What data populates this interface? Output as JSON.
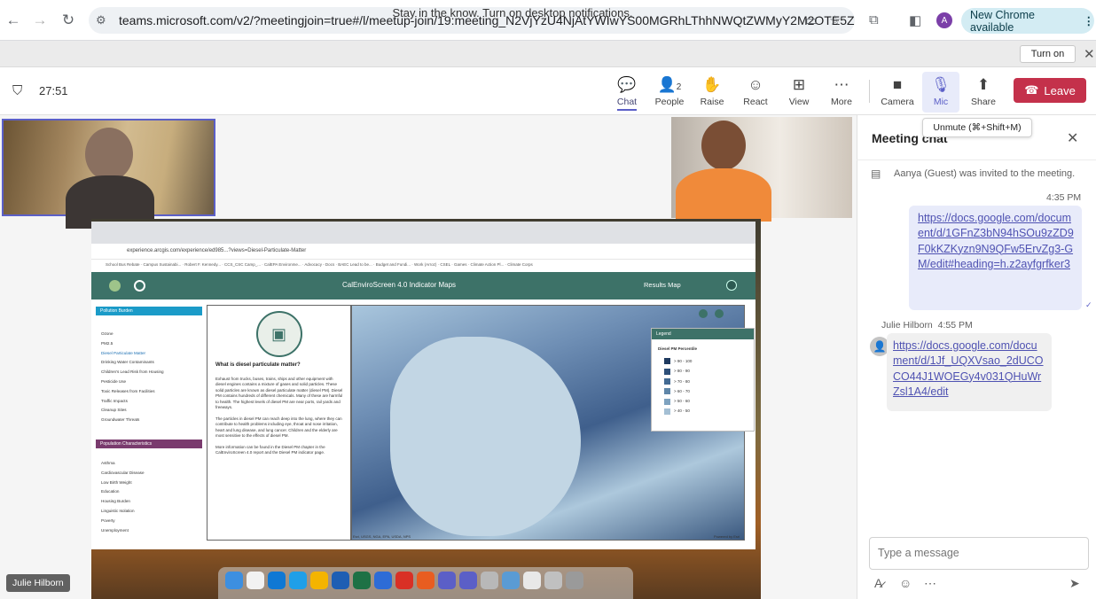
{
  "browser": {
    "url": "teams.microsoft.com/v2/?meetingjoin=true#/l/meetup-join/19:meeting_N2VjYzU4NjAtYWIwYS00MGRhLThhNWQtZWMyY2M2OTE5Zj...",
    "profile_initial": "A",
    "new_chrome_label": "New Chrome available"
  },
  "notification": {
    "text": "Stay in the know. Turn on desktop notifications.",
    "turn_on_label": "Turn on"
  },
  "meeting": {
    "timer": "27:51",
    "people_count": "2",
    "toolbar": {
      "chat": "Chat",
      "people": "People",
      "raise": "Raise",
      "react": "React",
      "view": "View",
      "more": "More",
      "camera": "Camera",
      "mic": "Mic",
      "share": "Share",
      "leave": "Leave"
    },
    "mic_tooltip": "Unmute (⌘+Shift+M)",
    "presenter_name": "Julie Hilborn"
  },
  "shared_screen": {
    "url": "experience.arcgis.com/experience/ed985...?views=Diesel-Particulate-Matter",
    "bookmarks": "School Bus Rebate · Campus Sustainabi... · Robert F. Kennedy... · CCS_CSC Camp_... · CalEPA Environme... · Advocacy - Docs · BAEC Lead to be... · Budget and Fundi... · Work (Arroz) · CSEL · Games · Climate Action Pl... · Climate Corps",
    "app_title": "CalEnviroScreen 4.0 Indicator Maps",
    "results_map": "Results Map",
    "pollution_header": "Pollution Burden",
    "pollution_items": [
      "Ozone",
      "PM2.5",
      "Diesel Particulate Matter",
      "Drinking Water Contaminants",
      "Children's Lead Risk from Housing",
      "Pesticide Use",
      "Toxic Releases from Facilities",
      "Traffic Impacts",
      "Cleanup Sites",
      "Groundwater Threats"
    ],
    "population_header": "Population Characteristics",
    "population_items": [
      "Asthma",
      "Cardiovascular Disease",
      "Low Birth Weight",
      "Education",
      "Housing Burden",
      "Linguistic Isolation",
      "Poverty",
      "Unemployment"
    ],
    "article_title": "What is diesel particulate matter?",
    "article_p1": "Exhaust from trucks, buses, trains, ships and other equipment with diesel engines contains a mixture of gases and solid particles. These solid particles are known as diesel particulate matter (diesel PM). Diesel PM contains hundreds of different chemicals. Many of these are harmful to health. The highest levels of diesel PM are near ports, rail yards and freeways.",
    "article_p2": "The particles in diesel PM can reach deep into the lung, where they can contribute to health problems including eye, throat and nose irritation, heart and lung disease, and lung cancer. Children and the elderly are most sensitive to the effects of diesel PM.",
    "article_p3": "More information can be found in the Diesel PM chapter in the CalEnviroScreen 4.0 report and the Diesel PM indicator page.",
    "legend_title": "Legend",
    "legend_layer": "Diesel PM Percentile",
    "legend_items": [
      "> 90 - 100",
      "> 80 - 90",
      "> 70 - 80",
      "> 60 - 70",
      "> 50 - 60",
      "> 40 - 50"
    ],
    "map_credit": "Esri, USGS, NGA, EPA, USDA, NPS",
    "map_powered": "Powered by Esri"
  },
  "chat": {
    "title": "Meeting chat",
    "system_message": "Aanya (Guest) was invited to the meeting.",
    "msg1_time": "4:35 PM",
    "msg1_link": "https://docs.google.com/document/d/1GFnZ3bN94hSOu9zZD9F0kKZKyzn9N9QFw5ErvZg3-GM/edit#heading=h.z2ayfgrfker3",
    "msg2_sender": "Julie Hilborn",
    "msg2_time": "4:55 PM",
    "msg2_link": "https://docs.google.com/document/d/1Jf_UQXVsao_2dUCOCO44J1WOEGy4v031QHuWrZsl1A4/edit",
    "compose_placeholder": "Type a message"
  },
  "colors": {
    "teams_accent": "#5b5fc7",
    "leave_red": "#c4314b",
    "arcgis_teal": "#3d7268",
    "pollution_blue": "#1b9bc8",
    "population_purple": "#7a3b6e"
  }
}
